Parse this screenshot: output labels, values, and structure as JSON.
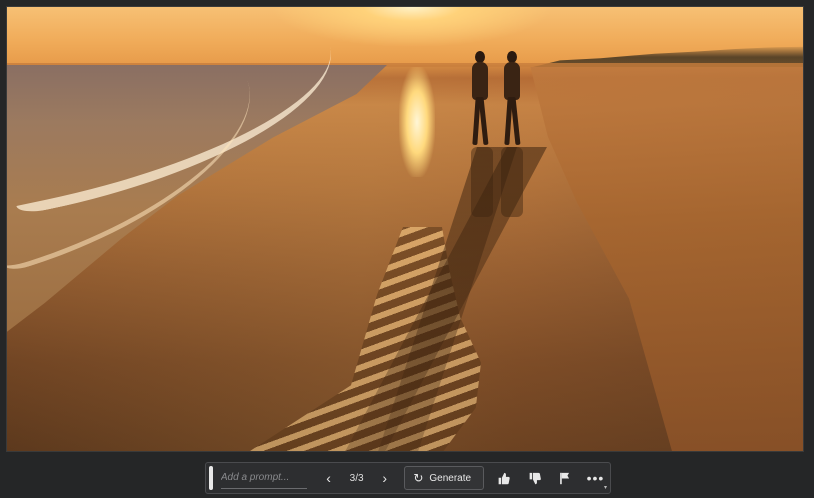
{
  "image": {
    "description_icon": "generated-image"
  },
  "toolbar": {
    "prompt_placeholder": "Add a prompt...",
    "prev_icon": "chevron-left-icon",
    "counter": "3/3",
    "next_icon": "chevron-right-icon",
    "generate_label": "Generate",
    "refresh_icon": "refresh-icon",
    "like_icon": "thumbs-up-icon",
    "dislike_icon": "thumbs-down-icon",
    "flag_icon": "flag-icon",
    "more_icon": "more-icon"
  }
}
